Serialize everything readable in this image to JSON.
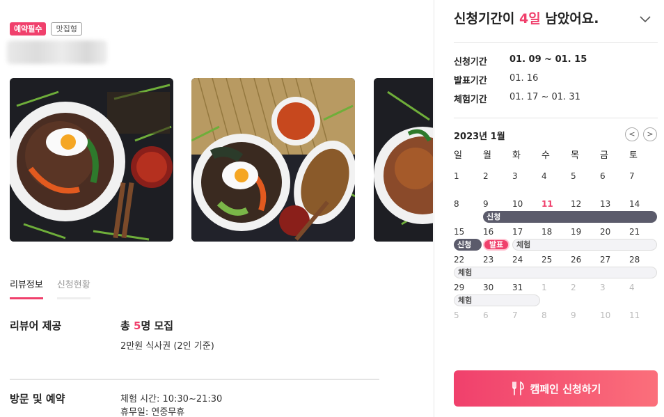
{
  "campaign": {
    "badges": {
      "reservation": "예약필수",
      "type": "맛집형"
    }
  },
  "tabs": [
    {
      "label": "리뷰정보"
    },
    {
      "label": "신청현황"
    }
  ],
  "reviewer_offer": {
    "label": "리뷰어 제공",
    "recruit_prefix": "총 ",
    "recruit_count": "5",
    "recruit_suffix": "명 모집",
    "detail": "2만원 식사권 (2인 기준)"
  },
  "visit": {
    "label": "방문 및 예약",
    "hours": "체험 시간: 10:30~21:30",
    "holiday": "휴무일: 연중무휴"
  },
  "panel": {
    "headline_prefix": "신청기간이 ",
    "headline_days": "4일",
    "headline_suffix": " 남았어요.",
    "periods": [
      {
        "key": "신청기간",
        "value": "01. 09 ~ 01. 15"
      },
      {
        "key": "발표기간",
        "value": "01. 16"
      },
      {
        "key": "체험기간",
        "value": "01. 17 ~ 01. 31"
      }
    ],
    "calendar": {
      "month": "2023년 1월",
      "prev": "<",
      "next": ">",
      "weekdays": [
        "일",
        "월",
        "화",
        "수",
        "목",
        "금",
        "토"
      ],
      "weeks": [
        [
          "1",
          "2",
          "3",
          "4",
          "5",
          "6",
          "7"
        ],
        [
          "8",
          "9",
          "10",
          "11",
          "12",
          "13",
          "14"
        ],
        [
          "15",
          "16",
          "17",
          "18",
          "19",
          "20",
          "21"
        ],
        [
          "22",
          "23",
          "24",
          "25",
          "26",
          "27",
          "28"
        ],
        [
          "29",
          "30",
          "31",
          "1",
          "2",
          "3",
          "4"
        ],
        [
          "5",
          "6",
          "7",
          "8",
          "9",
          "10",
          "11"
        ]
      ],
      "bar_labels": {
        "apply": "신청",
        "announce": "발표",
        "experience": "체험"
      }
    },
    "cta": "캠페인 신청하기"
  },
  "colors": {
    "accent": "#f0406c",
    "apply_bar": "#5b5b6b",
    "experience_bar": "#f3f3f6"
  },
  "icons": {
    "chevron": "chevron-down-icon",
    "cta": "fork-knife-icon"
  }
}
